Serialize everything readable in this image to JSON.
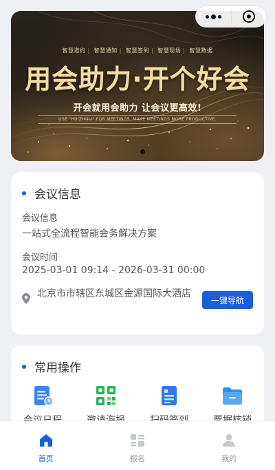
{
  "capsule": {
    "more_icon": "more-dots-icon",
    "close_icon": "target-circle-icon"
  },
  "banner": {
    "tags": [
      "智慧邀约",
      "智慧通知",
      "智慧签到",
      "智慧现场",
      "智慧数据"
    ],
    "headline": "用会助力·开个好会",
    "subline": "开会就用会助力 让会议更高效!",
    "english": "USE \"HUIZHULI\" FOR MEETINGS, MAKE MEETINGS MORE PRODUCTIVE."
  },
  "meeting_info": {
    "section_title": "会议信息",
    "info_label": "会议信息",
    "info_value": "一站式全流程智能会务解决方案",
    "time_label": "会议时间",
    "time_value": "2025-03-01 09:14 - 2026-03-31 00:00",
    "address": "北京市市辖区东城区金源国际大酒店",
    "navigate_label": "一键导航"
  },
  "operations": {
    "section_title": "常用操作",
    "items": [
      {
        "label": "会议日程",
        "icon": "schedule-doc-icon"
      },
      {
        "label": "邀请海报",
        "icon": "qr-code-icon"
      },
      {
        "label": "扫码签到",
        "icon": "scan-checkin-icon"
      },
      {
        "label": "票据核销",
        "icon": "folder-icon"
      }
    ]
  },
  "tabbar": {
    "items": [
      {
        "label": "首页",
        "icon": "home-icon",
        "active": true
      },
      {
        "label": "报名",
        "icon": "register-list-icon",
        "active": false
      },
      {
        "label": "我的",
        "icon": "user-icon",
        "active": false
      }
    ]
  },
  "colors": {
    "accent": "#1a5fd9",
    "gold": "#f2dca6",
    "page_bg": "#eef0f4"
  }
}
